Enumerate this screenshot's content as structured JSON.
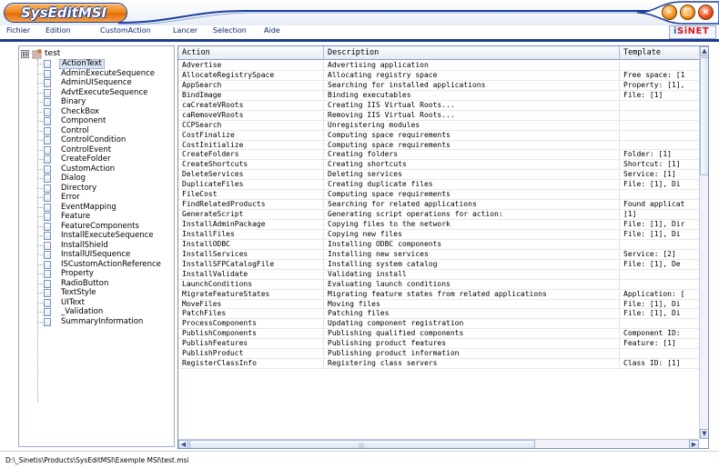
{
  "window": {
    "title": "SysEditMSI",
    "buttons": {
      "minimize_icon": "minimize-icon",
      "maximize_icon": "maximize-icon",
      "close_icon": "close-icon"
    }
  },
  "menu": {
    "items": [
      {
        "label": "Fichier"
      },
      {
        "label": "Edition"
      },
      {
        "label": "CustomAction"
      },
      {
        "label": "Lancer"
      },
      {
        "label": "Selection"
      },
      {
        "label": "Aide"
      }
    ]
  },
  "brand": {
    "prefix": "SiNET",
    "suffix": "iS"
  },
  "tree": {
    "root": "test",
    "toggle": "⊟",
    "items": [
      "ActionText",
      "AdminExecuteSequence",
      "AdminUISequence",
      "AdvtExecuteSequence",
      "Binary",
      "CheckBox",
      "Component",
      "Control",
      "ControlCondition",
      "ControlEvent",
      "CreateFolder",
      "CustomAction",
      "Dialog",
      "Directory",
      "Error",
      "EventMapping",
      "Feature",
      "FeatureComponents",
      "InstallExecuteSequence",
      "InstallShield",
      "InstallUISequence",
      "ISCustomActionReference",
      "Property",
      "RadioButton",
      "TextStyle",
      "UIText",
      "_Validation",
      "SummaryInformation"
    ],
    "selected_index": 0
  },
  "grid": {
    "columns": [
      "Action",
      "Description",
      "Template"
    ],
    "rows": [
      [
        "Advertise",
        "Advertising application",
        ""
      ],
      [
        "AllocateRegistrySpace",
        "Allocating registry space",
        "Free space: [1"
      ],
      [
        "AppSearch",
        "Searching for installed applications",
        "Property: [1],"
      ],
      [
        "BindImage",
        "Binding executables",
        "File: [1]"
      ],
      [
        "caCreateVRoots",
        "Creating IIS Virtual Roots...",
        ""
      ],
      [
        "caRemoveVRoots",
        "Removing IIS Virtual Roots...",
        ""
      ],
      [
        "CCPSearch",
        "Unregistering modules",
        ""
      ],
      [
        "CostFinalize",
        "Computing space requirements",
        ""
      ],
      [
        "CostInitialize",
        "Computing space requirements",
        ""
      ],
      [
        "CreateFolders",
        "Creating folders",
        "Folder: [1]"
      ],
      [
        "CreateShortcuts",
        "Creating shortcuts",
        "Shortcut: [1]"
      ],
      [
        "DeleteServices",
        "Deleting services",
        "Service: [1]"
      ],
      [
        "DuplicateFiles",
        "Creating duplicate files",
        "File: [1],  Di"
      ],
      [
        "FileCost",
        "Computing space requirements",
        ""
      ],
      [
        "FindRelatedProducts",
        "Searching for related applications",
        "Found applicat"
      ],
      [
        "GenerateScript",
        "Generating script operations for action:",
        "[1]"
      ],
      [
        "InstallAdminPackage",
        "Copying files to the network",
        "File: [1], Dir"
      ],
      [
        "InstallFiles",
        "Copying new files",
        "File: [1],  Di"
      ],
      [
        "InstallODBC",
        "Installing ODBC components",
        ""
      ],
      [
        "InstallServices",
        "Installing new services",
        "Service: [2]"
      ],
      [
        "InstallSFPCatalogFile",
        "Installing system catalog",
        "File: [1],  De"
      ],
      [
        "InstallValidate",
        "Validating install",
        ""
      ],
      [
        "LaunchConditions",
        "Evaluating launch conditions",
        ""
      ],
      [
        "MigrateFeatureStates",
        "Migrating feature states from related applications",
        "Application: ["
      ],
      [
        "MoveFiles",
        "Moving files",
        "File: [1],  Di"
      ],
      [
        "PatchFiles",
        "Patching files",
        "File: [1],  Di"
      ],
      [
        "ProcessComponents",
        "Updating component registration",
        ""
      ],
      [
        "PublishComponents",
        "Publishing qualified components",
        "Component ID:"
      ],
      [
        "PublishFeatures",
        "Publishing product features",
        "Feature: [1]"
      ],
      [
        "PublishProduct",
        "Publishing product information",
        ""
      ],
      [
        "RegisterClassInfo",
        "Registering class servers",
        "Class ID: [1]"
      ]
    ]
  },
  "status": {
    "path": "D:\\_Sinetis\\Products\\SysEditMSI\\Exemple MSI\\test.msi"
  }
}
